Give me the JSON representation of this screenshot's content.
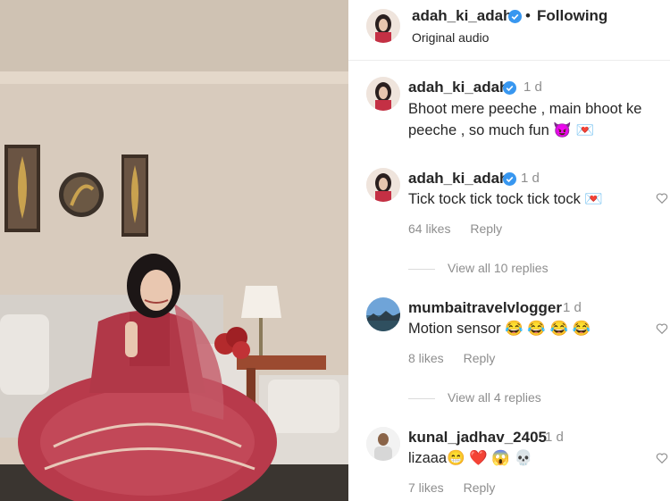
{
  "header": {
    "username": "adah_ki_adah",
    "separator": "•",
    "follow_status": "Following",
    "audio": "Original audio"
  },
  "comments": [
    {
      "username": "adah_ki_adah",
      "time": "1 d",
      "verified": true,
      "text": "Bhoot mere peeche , main bhoot ke peeche , so much fun 😈 💌"
    },
    {
      "username": "adah_ki_adah",
      "time": "1 d",
      "verified": true,
      "text": "Tick tock tick tock tick tock 💌",
      "likes": "64 likes",
      "reply": "Reply",
      "view_replies": "View all 10 replies"
    },
    {
      "username": "mumbaitravelvlogger",
      "time": "1 d",
      "verified": false,
      "text": "Motion sensor 😂 😂 😂 😂",
      "likes": "8 likes",
      "reply": "Reply",
      "view_replies": "View all 4 replies"
    },
    {
      "username": "kunal_jadhav_2405",
      "time": "1 d",
      "verified": false,
      "text": "lizaaa😁 ❤️ 😱 💀",
      "likes": "7 likes",
      "reply": "Reply"
    }
  ],
  "colors": {
    "verified": "#3897f0",
    "text": "#262626",
    "muted": "#8e8e8e",
    "lehenga": "#b83a4b"
  },
  "icons": [
    "verified-badge-icon",
    "heart-outline-icon"
  ]
}
